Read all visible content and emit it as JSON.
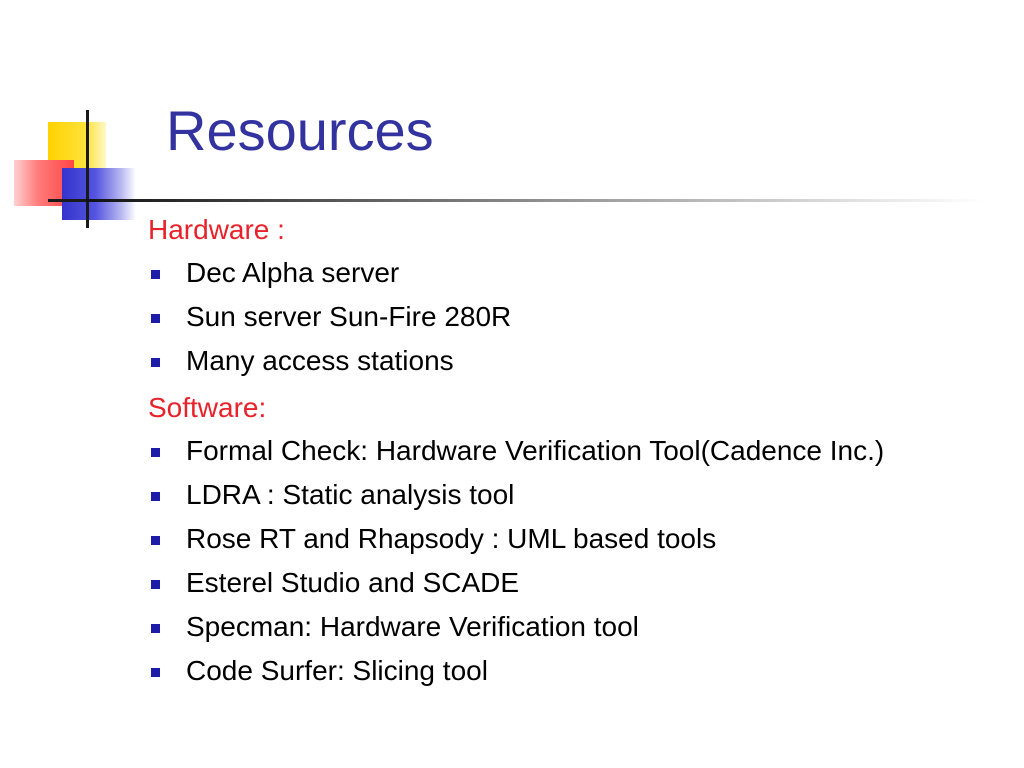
{
  "slide": {
    "title": "Resources",
    "sections": [
      {
        "heading": "Hardware :",
        "items": [
          "Dec Alpha server",
          "Sun server Sun-Fire 280R",
          "Many access stations"
        ]
      },
      {
        "heading": "Software:",
        "items": [
          "Formal Check:  Hardware Verification Tool(Cadence Inc.)",
          "LDRA : Static analysis tool",
          "Rose RT and Rhapsody : UML based tools",
          "Esterel Studio and SCADE",
          "Specman: Hardware Verification tool",
          "Code Surfer: Slicing tool"
        ]
      }
    ]
  },
  "colors": {
    "title": "#3333a0",
    "heading": "#e8222a",
    "bullet": "#1c1ca8",
    "logo_yellow": "#ffd200",
    "logo_red": "#ff4545",
    "logo_blue": "#3434cc"
  }
}
